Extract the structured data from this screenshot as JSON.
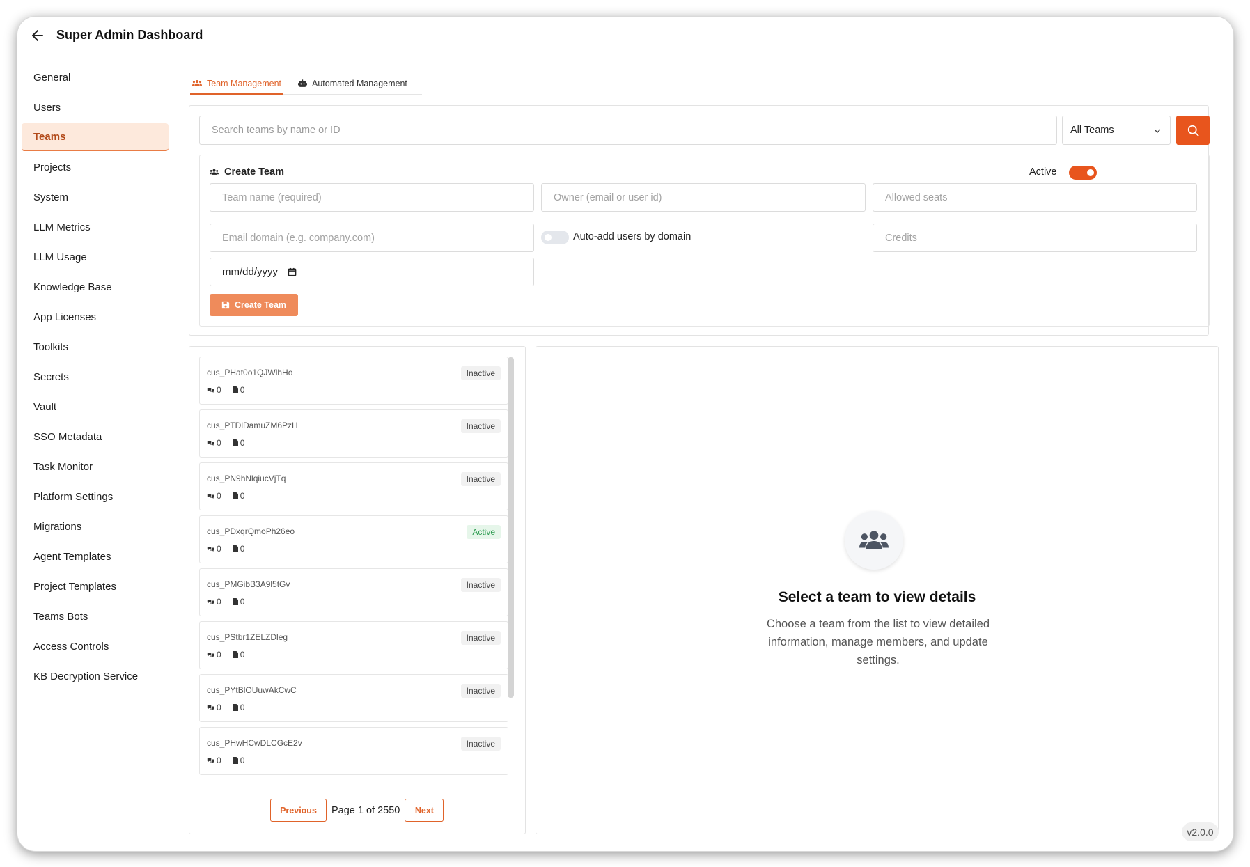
{
  "header": {
    "title": "Super Admin Dashboard"
  },
  "sidebar": {
    "items": [
      {
        "label": "General"
      },
      {
        "label": "Users"
      },
      {
        "label": "Teams",
        "active": true
      },
      {
        "label": "Projects"
      },
      {
        "label": "System"
      },
      {
        "label": "LLM Metrics"
      },
      {
        "label": "LLM Usage"
      },
      {
        "label": "Knowledge Base"
      },
      {
        "label": "App Licenses"
      },
      {
        "label": "Toolkits"
      },
      {
        "label": "Secrets"
      },
      {
        "label": "Vault"
      },
      {
        "label": "SSO Metadata"
      },
      {
        "label": "Task Monitor"
      },
      {
        "label": "Platform Settings"
      },
      {
        "label": "Migrations"
      },
      {
        "label": "Agent Templates"
      },
      {
        "label": "Project Templates"
      },
      {
        "label": "Teams Bots"
      },
      {
        "label": "Access Controls"
      },
      {
        "label": "KB Decryption Service"
      }
    ]
  },
  "tabs": [
    {
      "label": "Team Management",
      "active": true
    },
    {
      "label": "Automated Management",
      "active": false
    }
  ],
  "search": {
    "placeholder": "Search teams by name or ID",
    "filter_value": "All Teams"
  },
  "create": {
    "title": "Create Team",
    "active_label": "Active",
    "active_on": true,
    "team_name_placeholder": "Team name (required)",
    "owner_placeholder": "Owner (email or user id)",
    "seats_placeholder": "Allowed seats",
    "domain_placeholder": "Email domain (e.g. company.com)",
    "auto_add_label": "Auto-add users by domain",
    "auto_add_on": false,
    "credits_placeholder": "Credits",
    "date_value": "mm/dd/yyyy",
    "button_label": "Create Team"
  },
  "teams": [
    {
      "id": "cus_PHat0o1QJWlhHo",
      "status": "Inactive",
      "members": "0",
      "docs": "0"
    },
    {
      "id": "cus_PTDlDamuZM6PzH",
      "status": "Inactive",
      "members": "0",
      "docs": "0"
    },
    {
      "id": "cus_PN9hNlqiucVjTq",
      "status": "Inactive",
      "members": "0",
      "docs": "0"
    },
    {
      "id": "cus_PDxqrQmoPh26eo",
      "status": "Active",
      "members": "0",
      "docs": "0"
    },
    {
      "id": "cus_PMGibB3A9l5tGv",
      "status": "Inactive",
      "members": "0",
      "docs": "0"
    },
    {
      "id": "cus_PStbr1ZELZDleg",
      "status": "Inactive",
      "members": "0",
      "docs": "0"
    },
    {
      "id": "cus_PYtBlOUuwAkCwC",
      "status": "Inactive",
      "members": "0",
      "docs": "0"
    },
    {
      "id": "cus_PHwHCwDLCGcE2v",
      "status": "Inactive",
      "members": "0",
      "docs": "0"
    }
  ],
  "pagination": {
    "previous_label": "Previous",
    "page_info": "Page 1 of 2550",
    "next_label": "Next"
  },
  "detail": {
    "empty_title": "Select a team to view details",
    "empty_desc": "Choose a team from the list to view detailed information, manage members, and update settings."
  },
  "version": "v2.0.0",
  "colors": {
    "accent": "#e8551d",
    "active_bg": "#fde9dc",
    "success": "#2f9d52"
  },
  "icons": [
    "back-arrow-icon",
    "users-icon",
    "robot-icon",
    "search-icon",
    "chevron-down-icon",
    "calendar-icon",
    "save-icon",
    "comments-icon",
    "file-icon"
  ]
}
